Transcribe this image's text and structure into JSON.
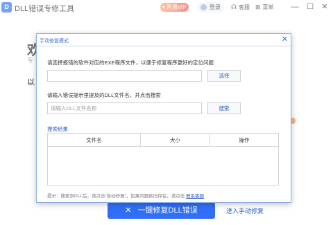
{
  "app": {
    "logo_text": "D",
    "title": "DLL错误专修工具",
    "vip_label": "开通VIP",
    "login_label": "登录",
    "service_label": "客服",
    "menu_label": "菜单",
    "min_glyph": "—",
    "max_glyph": "☐",
    "close_glyph": "✕"
  },
  "background": {
    "heading": "欢",
    "subtitle": "专",
    "list_title": "以",
    "bullets": [
      "·",
      "·",
      "·",
      "·",
      "·",
      "·",
      "·",
      "·"
    ],
    "main_button_label": "一键修复DLL错误",
    "main_button_icon": "✕",
    "manual_link": "进入手动修复"
  },
  "dialog": {
    "title": "手动修复模式",
    "close_glyph": "✕",
    "exe_label": "请选择报错的软件对应的EXE程序文件，以便于修复程序更好的定位问题",
    "exe_value": "",
    "select_button": "选择",
    "dll_label": "请输入错误提示里提及的DLL文件名，并点击搜索",
    "dll_placeholder": "请输入DLL文件名称",
    "search_button": "搜索",
    "results_title": "搜索结果",
    "table_headers": [
      "文件名",
      "大小",
      "操作"
    ],
    "hint_text": "提示：搜索到DLL后，请点击“自动修复”，如果问题依旧存在，请点击",
    "hint_link": "联系客服"
  },
  "colors": {
    "accent": "#2f6ef5",
    "link": "#2a5cd1",
    "vip_gradient_start": "#f8a36c",
    "vip_gradient_end": "#ef5a5a"
  }
}
